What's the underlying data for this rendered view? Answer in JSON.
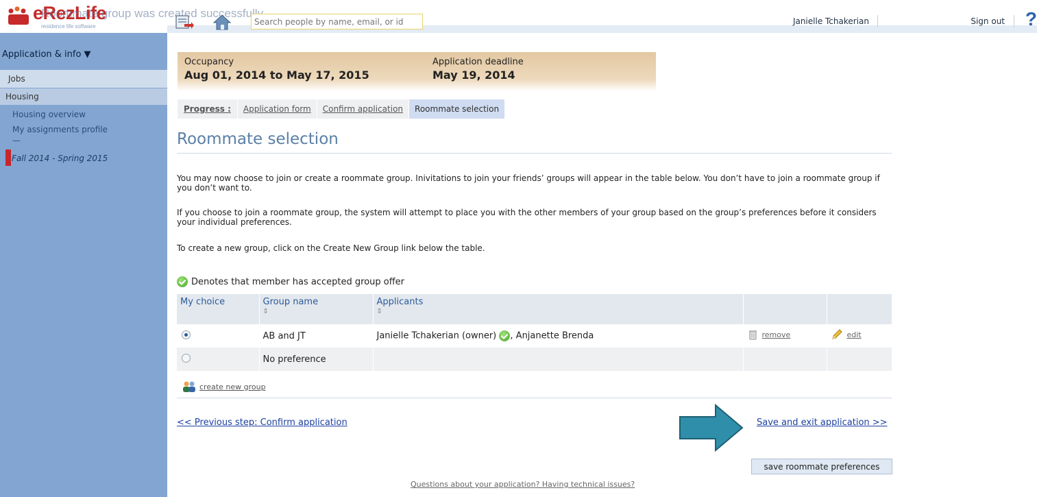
{
  "header": {
    "logo_text": "eRezLife",
    "logo_tagline": "residence life software",
    "flash_message": "Roommate group was created successfully",
    "search_placeholder": "Search people by name, email, or id",
    "user_name": "Janielle Tchakerian",
    "sign_out": "Sign out",
    "help": "?"
  },
  "sidebar": {
    "section_title": "Application & info ▼",
    "jobs": "Jobs",
    "housing": "Housing",
    "housing_overview": "Housing overview",
    "assignments_profile": "My assignments profile",
    "dash": "—",
    "term": "Fall 2014 - Spring 2015"
  },
  "info": {
    "occupancy_label": "Occupancy",
    "occupancy_value": "Aug 01, 2014 to May 17, 2015",
    "deadline_label": "Application deadline",
    "deadline_value": "May 19, 2014"
  },
  "progress": {
    "label": "Progress :",
    "steps": [
      "Application form",
      "Confirm application",
      "Roommate selection"
    ]
  },
  "page": {
    "title": "Roommate selection",
    "para1": "You may now choose to join or create a roommate group. Inivitations to join your friends’ groups will appear in the table below. You don’t have to join a roommate group if you don’t want to.",
    "para2": "If you choose to join a roommate group, the system will attempt to place you with the other members of your group based on the group’s preferences before it considers your individual preferences.",
    "para3": "To create a new group, click on the Create New Group link below the table.",
    "legend": "Denotes that member has accepted group offer"
  },
  "table": {
    "headers": [
      "My choice",
      "Group name",
      "Applicants",
      "",
      ""
    ],
    "sort_glyph": "⇕",
    "rows": [
      {
        "group": "AB and JT",
        "owner": "Janielle Tchakerian (owner)",
        "others": ", Anjanette Brenda",
        "remove": "remove",
        "edit": "edit"
      },
      {
        "group": "No preference"
      }
    ]
  },
  "actions": {
    "create_group": "create new group",
    "prev": "<< Previous step: Confirm application",
    "next": "Save and exit application >>",
    "save": "save roommate preferences",
    "footer": "Questions about your application? Having technical issues?"
  },
  "colors": {
    "sidebar": "#82a6d1",
    "arrow": "#2f8faa",
    "title": "#5a7fa6"
  }
}
